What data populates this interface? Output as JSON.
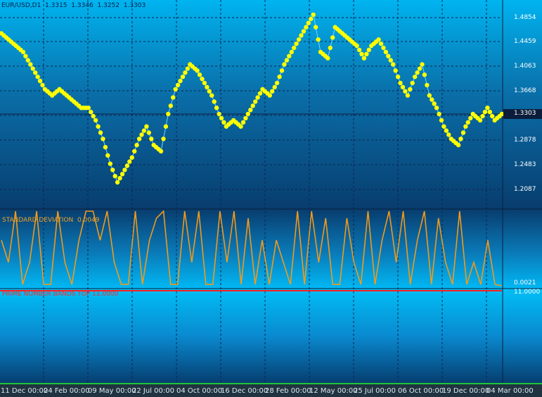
{
  "chart_header": {
    "symbol_tf": "EUR/USD,D1",
    "open": "1.3315",
    "high": "1.3346",
    "low": "1.3252",
    "close": "1.3303"
  },
  "price_axis": [
    "1.4854",
    "1.4459",
    "1.4063",
    "1.3668",
    "1.2878",
    "1.2483",
    "1.2087"
  ],
  "price_current": "1.3303",
  "indicators": {
    "std_dev": {
      "name": "STANDARD DEVIATION",
      "value": "0.0049",
      "axis_label": "0.0021"
    },
    "prime_bands": {
      "name": "PRIME NUMBER BANDS TOP",
      "value": "11.0000",
      "axis_label": "11.0000"
    }
  },
  "time_axis": [
    "11 Dec 00:00",
    "24 Feb 00:00",
    "09 May 00:00",
    "22 Jul 00:00",
    "04 Oct 00:00",
    "16 Dec 00:00",
    "28 Feb 00:00",
    "12 May 00:00",
    "25 Jul 00:00",
    "06 Oct 00:00",
    "19 Dec 00:00",
    "04 Mar 00:00"
  ],
  "colors": {
    "price_dots": "#ffff00",
    "price_line": "#6fd8ff",
    "std_line": "#f29a1a",
    "prime_line": "#ff1e1e",
    "grid": "#0b2350",
    "axis_line": "#22c43a"
  },
  "chart_data": {
    "type": "line",
    "series": [
      {
        "name": "EUR/USD,D1",
        "y": [
          1.46,
          1.45,
          1.44,
          1.43,
          1.41,
          1.39,
          1.37,
          1.36,
          1.37,
          1.36,
          1.35,
          1.34,
          1.34,
          1.32,
          1.29,
          1.25,
          1.22,
          1.24,
          1.26,
          1.29,
          1.31,
          1.28,
          1.27,
          1.33,
          1.37,
          1.39,
          1.41,
          1.4,
          1.38,
          1.36,
          1.33,
          1.31,
          1.32,
          1.31,
          1.33,
          1.35,
          1.37,
          1.36,
          1.38,
          1.41,
          1.43,
          1.45,
          1.47,
          1.49,
          1.43,
          1.42,
          1.47,
          1.46,
          1.45,
          1.44,
          1.42,
          1.44,
          1.45,
          1.43,
          1.41,
          1.38,
          1.36,
          1.39,
          1.41,
          1.36,
          1.34,
          1.31,
          1.29,
          1.28,
          1.31,
          1.33,
          1.32,
          1.34,
          1.32,
          1.33
        ]
      },
      {
        "name": "STANDARD DEVIATION",
        "y": [
          0.004,
          0.003,
          0.007,
          0.002,
          0.003,
          0.006,
          0.002,
          0.002,
          0.008,
          0.003,
          0.002,
          0.004,
          0.006,
          0.022,
          0.004,
          0.012,
          0.003,
          0.002,
          0.002,
          0.011,
          0.002,
          0.004,
          0.005,
          0.013,
          0.002,
          0.002,
          0.008,
          0.003,
          0.006,
          0.002,
          0.002,
          0.009,
          0.003,
          0.011,
          0.002,
          0.005,
          0.002,
          0.004,
          0.002,
          0.004,
          0.003,
          0.002,
          0.007,
          0.002,
          0.016,
          0.003,
          0.005,
          0.002,
          0.002,
          0.005,
          0.003,
          0.002,
          0.007,
          0.002,
          0.004,
          0.013,
          0.003,
          0.006,
          0.002,
          0.004,
          0.015,
          0.002,
          0.005,
          0.003,
          0.002,
          0.007,
          0.002,
          0.003,
          0.002,
          0.004,
          0.002,
          0.001
        ]
      }
    ],
    "yaxis": {
      "price_ticks": [
        "1.4854",
        "1.4459",
        "1.4063",
        "1.3668",
        "1.2878",
        "1.2483",
        "1.2087"
      ]
    }
  }
}
